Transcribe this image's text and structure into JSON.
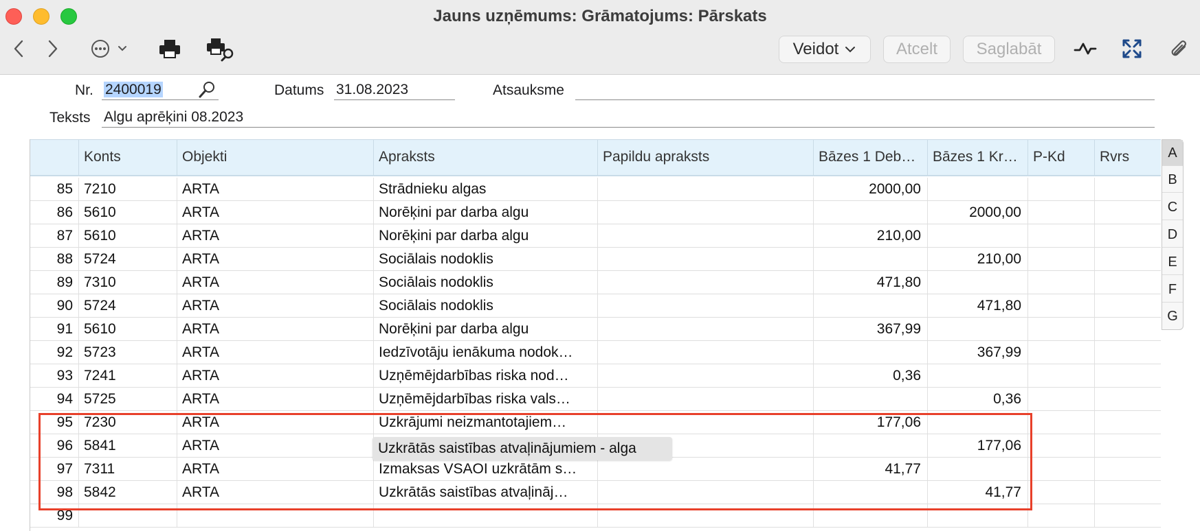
{
  "window": {
    "title": "Jauns uzņēmums: Grāmatojums: Pārskats"
  },
  "toolbar": {
    "veidot_label": "Veidot",
    "atcelt_label": "Atcelt",
    "saglabat_label": "Saglabāt",
    "icons": [
      "back-icon",
      "forward-icon",
      "more-icon",
      "print-icon",
      "print-preview-icon",
      "activity-icon",
      "expand-icon",
      "attachment-icon"
    ]
  },
  "form": {
    "nr_label": "Nr.",
    "nr_value": "2400019",
    "datums_label": "Datums",
    "datums_value": "31.08.2023",
    "atsauksme_label": "Atsauksme",
    "atsauksme_value": "",
    "teksts_label": "Teksts",
    "teksts_value": "Algu aprēķini 08.2023"
  },
  "grid": {
    "columns": [
      "",
      "Konts",
      "Objekti",
      "Apraksts",
      "Papildu apraksts",
      "Bāzes 1 Deb…",
      "Bāzes 1 Kr…",
      "P-Kd",
      "Rvrs"
    ],
    "rows": [
      {
        "num": "85",
        "konts": "7210",
        "objekti": "ARTA",
        "apraksts": "Strādnieku algas",
        "papildu": "",
        "debets": "2000,00",
        "kredits": "",
        "pkd": "",
        "rvrs": ""
      },
      {
        "num": "86",
        "konts": "5610",
        "objekti": "ARTA",
        "apraksts": "Norēķini par darba algu",
        "papildu": "",
        "debets": "",
        "kredits": "2000,00",
        "pkd": "",
        "rvrs": ""
      },
      {
        "num": "87",
        "konts": "5610",
        "objekti": "ARTA",
        "apraksts": "Norēķini par darba algu",
        "papildu": "",
        "debets": "210,00",
        "kredits": "",
        "pkd": "",
        "rvrs": ""
      },
      {
        "num": "88",
        "konts": "5724",
        "objekti": "ARTA",
        "apraksts": "Sociālais nodoklis",
        "papildu": "",
        "debets": "",
        "kredits": "210,00",
        "pkd": "",
        "rvrs": ""
      },
      {
        "num": "89",
        "konts": "7310",
        "objekti": "ARTA",
        "apraksts": "Sociālais nodoklis",
        "papildu": "",
        "debets": "471,80",
        "kredits": "",
        "pkd": "",
        "rvrs": ""
      },
      {
        "num": "90",
        "konts": "5724",
        "objekti": "ARTA",
        "apraksts": "Sociālais nodoklis",
        "papildu": "",
        "debets": "",
        "kredits": "471,80",
        "pkd": "",
        "rvrs": ""
      },
      {
        "num": "91",
        "konts": "5610",
        "objekti": "ARTA",
        "apraksts": "Norēķini par darba algu",
        "papildu": "",
        "debets": "367,99",
        "kredits": "",
        "pkd": "",
        "rvrs": ""
      },
      {
        "num": "92",
        "konts": "5723",
        "objekti": "ARTA",
        "apraksts": "Iedzīvotāju ienākuma nodok…",
        "papildu": "",
        "debets": "",
        "kredits": "367,99",
        "pkd": "",
        "rvrs": ""
      },
      {
        "num": "93",
        "konts": "7241",
        "objekti": "ARTA",
        "apraksts": "Uzņēmējdarbības riska nod…",
        "papildu": "",
        "debets": "0,36",
        "kredits": "",
        "pkd": "",
        "rvrs": ""
      },
      {
        "num": "94",
        "konts": "5725",
        "objekti": "ARTA",
        "apraksts": "Uzņēmējdarbības riska vals…",
        "papildu": "",
        "debets": "",
        "kredits": "0,36",
        "pkd": "",
        "rvrs": ""
      },
      {
        "num": "95",
        "konts": "7230",
        "objekti": "ARTA",
        "apraksts": "Uzkrājumi neizmantotajiem…",
        "papildu": "",
        "debets": "177,06",
        "kredits": "",
        "pkd": "",
        "rvrs": ""
      },
      {
        "num": "96",
        "konts": "5841",
        "objekti": "ARTA",
        "apraksts": "",
        "papildu": "",
        "debets": "",
        "kredits": "177,06",
        "pkd": "",
        "rvrs": ""
      },
      {
        "num": "97",
        "konts": "7311",
        "objekti": "ARTA",
        "apraksts": "Izmaksas VSAOI uzkrātām s…",
        "papildu": "",
        "debets": "41,77",
        "kredits": "",
        "pkd": "",
        "rvrs": ""
      },
      {
        "num": "98",
        "konts": "5842",
        "objekti": "ARTA",
        "apraksts": "Uzkrātās saistības atvaļināj…",
        "papildu": "",
        "debets": "",
        "kredits": "41,77",
        "pkd": "",
        "rvrs": ""
      },
      {
        "num": "99",
        "konts": "",
        "objekti": "",
        "apraksts": "",
        "papildu": "",
        "debets": "",
        "kredits": "",
        "pkd": "",
        "rvrs": ""
      }
    ],
    "tooltip": "Uzkrātās saistības atvaļinājumiem - alga"
  },
  "side_tabs": [
    "A",
    "B",
    "C",
    "D",
    "E",
    "F",
    "G"
  ],
  "colors": {
    "header_bg": "#e3f2fb",
    "highlight_border": "#e8402a",
    "selection": "#b5d5ff"
  }
}
